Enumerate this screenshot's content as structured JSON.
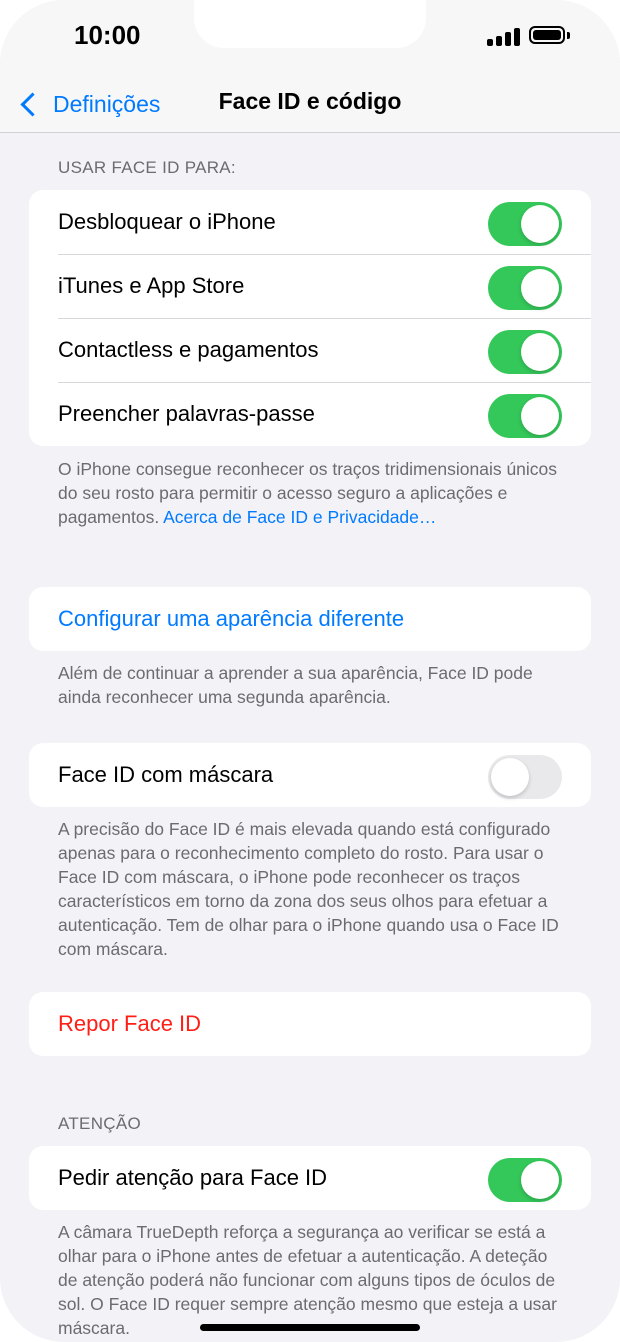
{
  "status_bar": {
    "time": "10:00"
  },
  "nav": {
    "back_label": "Definições",
    "title": "Face ID e código"
  },
  "face_id_section": {
    "header": "USAR FACE ID PARA:",
    "rows": [
      {
        "label": "Desbloquear o iPhone",
        "enabled": true
      },
      {
        "label": "iTunes e App Store",
        "enabled": true
      },
      {
        "label": "Contactless e pagamentos",
        "enabled": true
      },
      {
        "label": "Preencher palavras-passe",
        "enabled": true
      }
    ],
    "footer_text": "O iPhone consegue reconhecer os traços tridimensionais únicos do seu rosto para permitir o acesso seguro a aplicações e pagamentos. ",
    "footer_link": "Acerca de Face ID e Privacidade…"
  },
  "appearance_section": {
    "button_label": "Configurar uma aparência diferente",
    "footer_text": "Além de continuar a aprender a sua aparência, Face ID pode ainda reconhecer uma segunda aparência."
  },
  "mask_section": {
    "label": "Face ID com máscara",
    "enabled": false,
    "footer_text": "A precisão do Face ID é mais elevada quando está configurado apenas para o reconhecimento completo do rosto. Para usar o Face ID com máscara, o iPhone pode reconhecer os traços característicos em torno da zona dos seus olhos para efetuar a autenticação. Tem de olhar para o iPhone quando usa o Face ID com máscara."
  },
  "reset_section": {
    "button_label": "Repor Face ID"
  },
  "attention_section": {
    "header": "ATENÇÃO",
    "label": "Pedir atenção para Face ID",
    "enabled": true,
    "footer_text": "A câmara TrueDepth reforça a segurança ao verificar se está a olhar para o iPhone antes de efetuar a autenticação. A deteção de atenção poderá não funcionar com alguns tipos de óculos de sol. O Face ID requer sempre atenção mesmo que esteja a usar máscara."
  },
  "colors": {
    "accent": "#007aff",
    "toggle_on": "#34c759",
    "toggle_off": "#e9e9eb",
    "destructive": "#ff1f17",
    "background": "#f2f2f7"
  }
}
